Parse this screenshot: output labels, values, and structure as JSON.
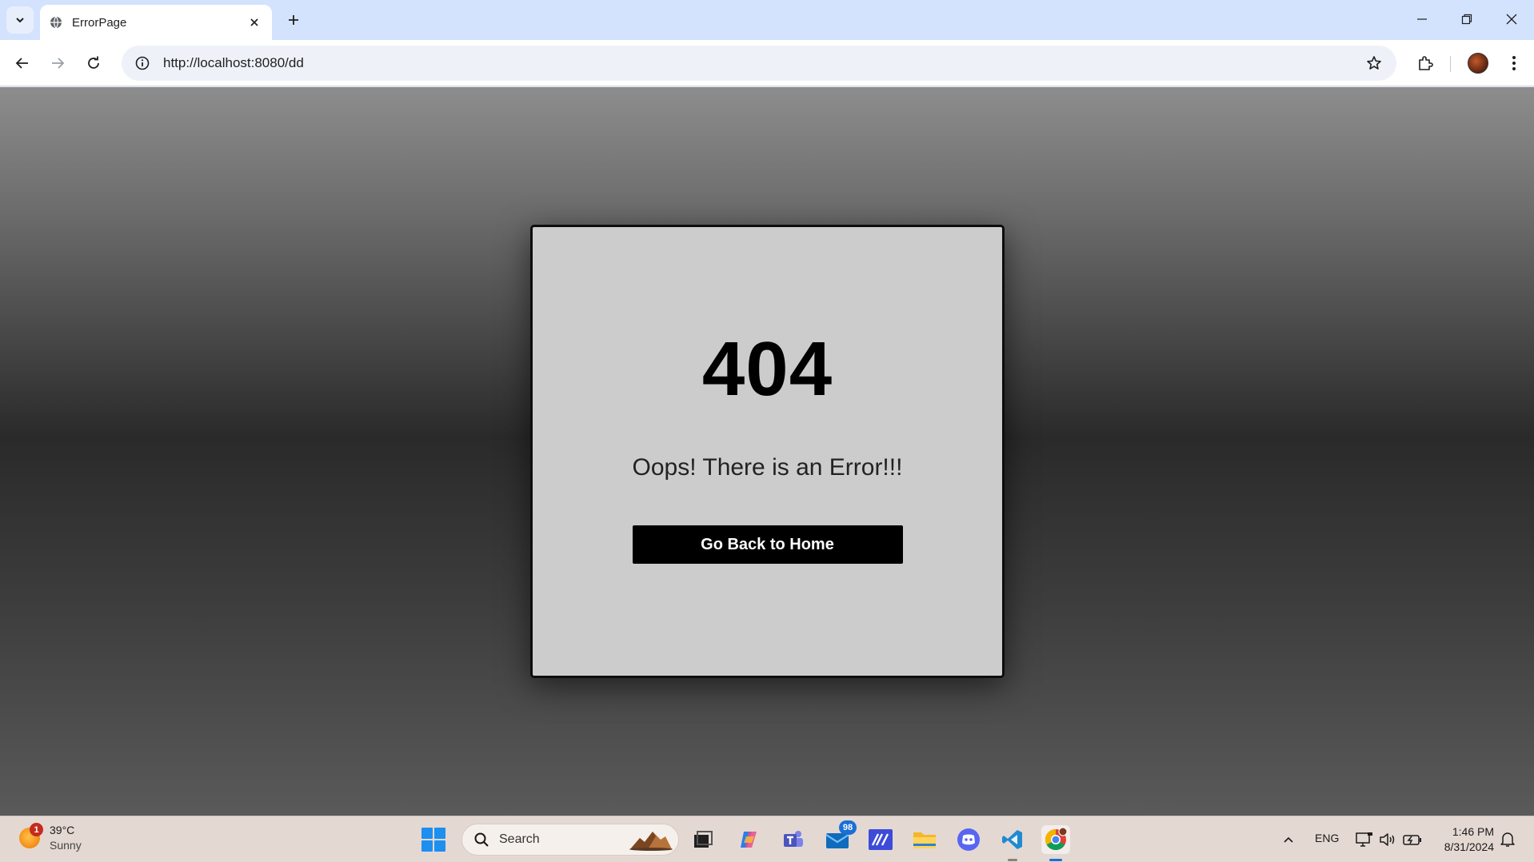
{
  "browser": {
    "tab_title": "ErrorPage",
    "url": "http://localhost:8080/dd"
  },
  "page": {
    "error_code": "404",
    "error_message": "Oops! There is an Error!!!",
    "home_button_label": "Go Back to Home",
    "card_background": "#cccccc",
    "button_background": "#000000"
  },
  "taskbar": {
    "weather": {
      "temperature": "39°C",
      "condition": "Sunny",
      "alert_count": "1"
    },
    "search_placeholder": "Search",
    "apps": [
      {
        "name": "task-view",
        "icon": "task-view-icon"
      },
      {
        "name": "copilot",
        "icon": "copilot-icon"
      },
      {
        "name": "teams",
        "icon": "teams-icon"
      },
      {
        "name": "mail",
        "icon": "mail-icon",
        "badge": "98"
      },
      {
        "name": "visual-studio",
        "icon": "visual-studio-icon"
      },
      {
        "name": "file-explorer",
        "icon": "folder-icon"
      },
      {
        "name": "discord",
        "icon": "discord-icon"
      },
      {
        "name": "vscode",
        "icon": "vscode-icon"
      },
      {
        "name": "chrome",
        "icon": "chrome-icon",
        "active": true
      }
    ],
    "tray": {
      "language": "ENG",
      "time": "1:46 PM",
      "date": "8/31/2024"
    }
  }
}
